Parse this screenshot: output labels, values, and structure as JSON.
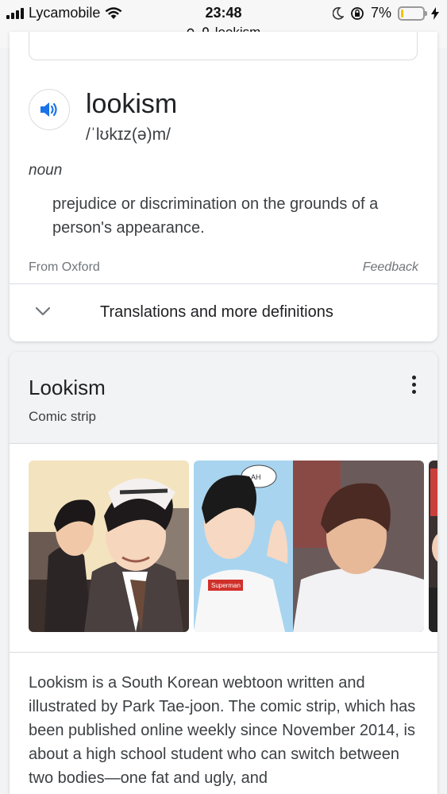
{
  "status_bar": {
    "carrier": "Lycamobile",
    "time": "23:48",
    "battery": "7%",
    "url": "lookism"
  },
  "dictionary": {
    "word": "lookism",
    "phonetic": "/ˈlʊkɪz(ə)m/",
    "part_of_speech": "noun",
    "definition": "prejudice or discrimination on the grounds of a person's appearance.",
    "source": "From Oxford",
    "feedback": "Feedback",
    "more_link": "Translations and more definitions"
  },
  "knowledge_panel": {
    "title": "Lookism",
    "subtitle": "Comic strip",
    "images": [
      {
        "caption": "",
        "sign_text": ""
      },
      {
        "caption": "Superman",
        "bubble": "AH"
      },
      {
        "caption": ""
      }
    ],
    "description": "Lookism is a South Korean webtoon written and illustrated by Park Tae-joon. The comic strip, which has been published online weekly since November 2014, is about a high school student who can switch between two bodies—one fat and ugly, and"
  },
  "colors": {
    "accent_blue": "#1a73e8",
    "battery_yellow": "#f6c300"
  }
}
